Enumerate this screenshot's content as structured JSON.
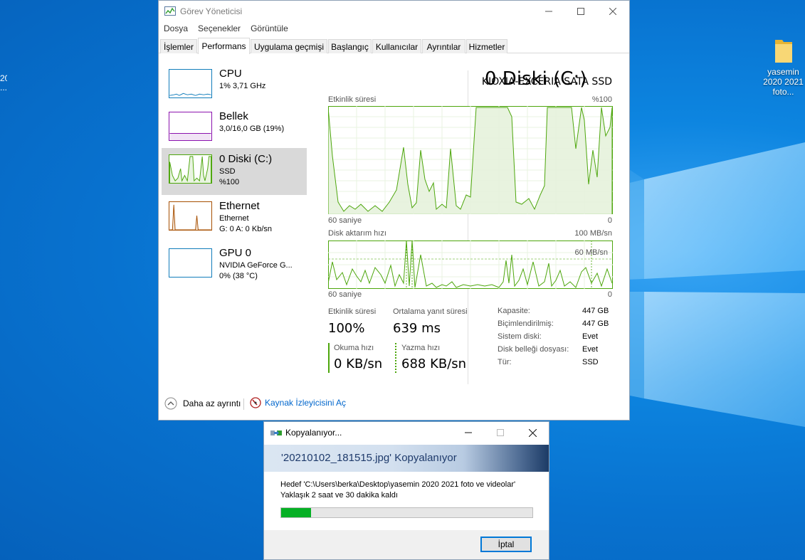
{
  "desktop": {
    "left_label_lines": [
      "20",
      "..."
    ],
    "icon": {
      "label": "yasemin 2020 2021 foto...",
      "icon": "folder-icon"
    }
  },
  "task_manager": {
    "title": "Görev Yöneticisi",
    "menu": [
      "Dosya",
      "Seçenekler",
      "Görüntüle"
    ],
    "tabs": [
      "İşlemler",
      "Performans",
      "Uygulama geçmişi",
      "Başlangıç",
      "Kullanıcılar",
      "Ayrıntılar",
      "Hizmetler"
    ],
    "active_tab": "Performans",
    "sidebar": [
      {
        "name": "CPU",
        "sub1": "1% 3,71 GHz",
        "color": "#117dbb"
      },
      {
        "name": "Bellek",
        "sub1": "3,0/16,0 GB (19%)",
        "color": "#8b12ae"
      },
      {
        "name": "0 Diski (C:)",
        "sub1": "SSD",
        "sub2": "%100",
        "color": "#4da60c"
      },
      {
        "name": "Ethernet",
        "sub1": "Ethernet",
        "sub2": "G: 0 A: 0 Kb/sn",
        "color": "#a74f01"
      },
      {
        "name": "GPU 0",
        "sub1": "NVIDIA GeForce G...",
        "sub2": "0% (38 °C)",
        "color": "#117dbb"
      }
    ],
    "detail": {
      "title": "0 Diski (C:)",
      "model": "KIOXIA-EXCERIA SATA SSD",
      "graph1": {
        "label": "Etkinlik süresi",
        "max": "%100",
        "time": "60 saniye",
        "zero": "0"
      },
      "graph2": {
        "label": "Disk aktarım hızı",
        "max": "100 MB/sn",
        "inner": "60 MB/sn",
        "time": "60 saniye",
        "zero": "0"
      },
      "stats": {
        "active_label": "Etkinlik süresi",
        "active_value": "100%",
        "resp_label": "Ortalama yanıt süresi",
        "resp_value": "639 ms",
        "read_label": "Okuma hızı",
        "read_value": "0 KB/sn",
        "write_label": "Yazma hızı",
        "write_value": "688 KB/sn"
      },
      "properties": [
        {
          "label": "Kapasite:",
          "value": "447 GB"
        },
        {
          "label": "Biçimlendirilmiş:",
          "value": "447 GB"
        },
        {
          "label": "Sistem diski:",
          "value": "Evet"
        },
        {
          "label": "Disk belleği dosyası:",
          "value": "Evet"
        },
        {
          "label": "Tür:",
          "value": "SSD"
        }
      ]
    },
    "footer": {
      "less_details": "Daha az ayrıntı",
      "resource_monitor": "Kaynak İzleyicisini Aç"
    },
    "accent_color": "#4da60c"
  },
  "copy_dialog": {
    "title": "Kopyalanıyor...",
    "header": "'20210102_181515.jpg' Kopyalanıyor",
    "destination": "Hedef 'C:\\Users\\berka\\Desktop\\yasemin 2020 2021 foto ve videolar'",
    "remaining": "Yaklaşık 2 saat ve 30 dakika kaldı",
    "progress_fraction": 0.12,
    "cancel_label": "İptal"
  }
}
